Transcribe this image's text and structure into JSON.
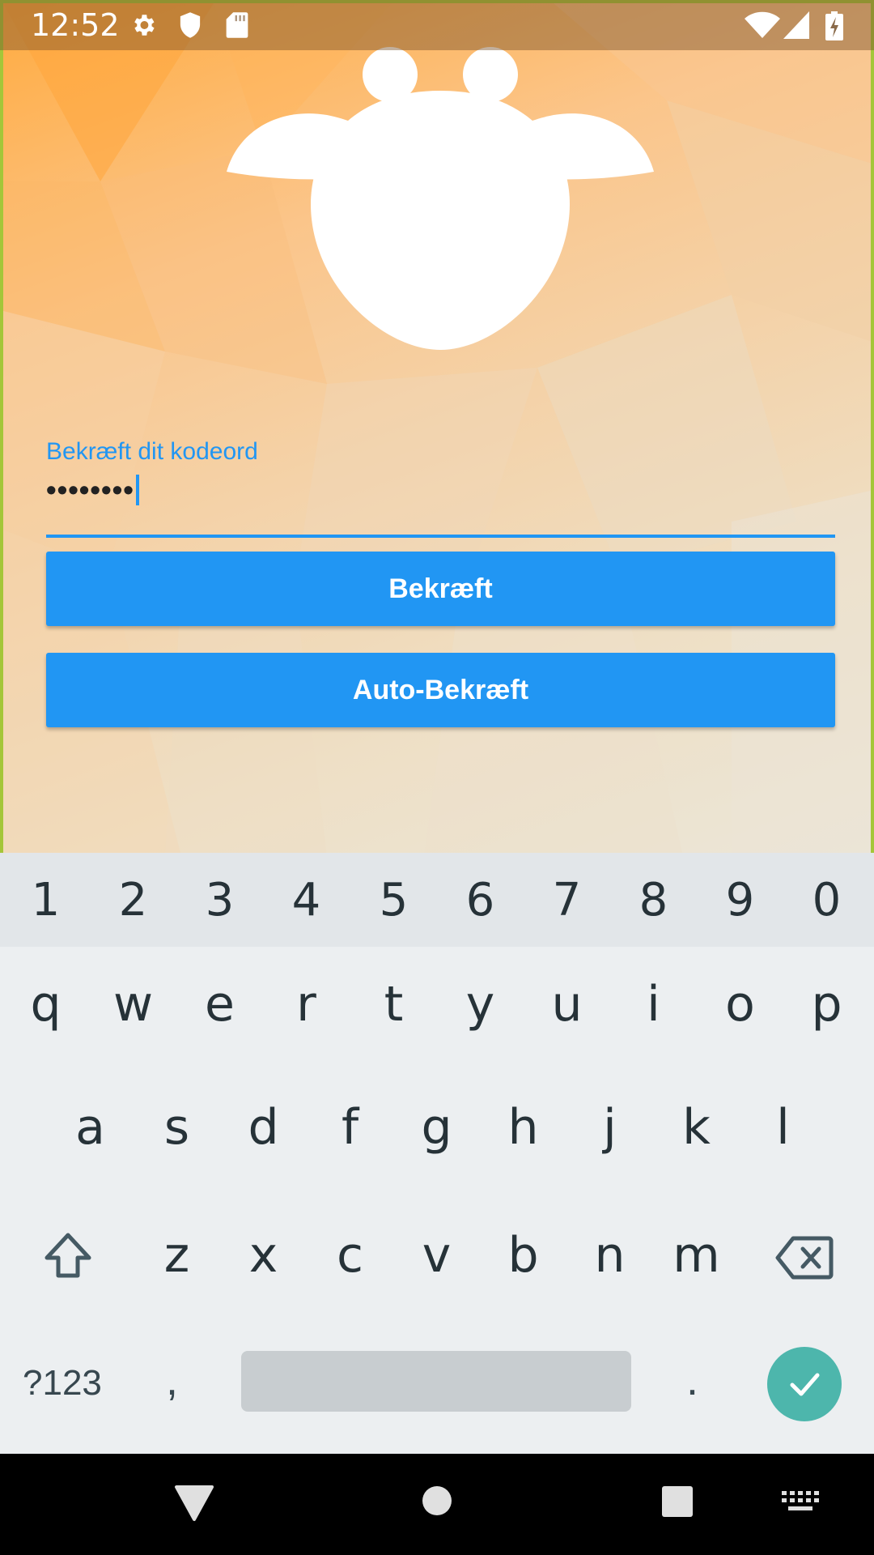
{
  "status_bar": {
    "time": "12:52",
    "icons": [
      "settings-icon",
      "shield-icon",
      "sd-card-icon",
      "wifi-icon",
      "signal-icon",
      "battery-charging-icon"
    ]
  },
  "login": {
    "field_label": "Bekræft dit kodeord",
    "password_value": "••••••••",
    "confirm_button": "Bekræft",
    "auto_confirm_button": "Auto-Bekræft"
  },
  "keyboard": {
    "number_row": [
      "1",
      "2",
      "3",
      "4",
      "5",
      "6",
      "7",
      "8",
      "9",
      "0"
    ],
    "row_q": [
      "q",
      "w",
      "e",
      "r",
      "t",
      "y",
      "u",
      "i",
      "o",
      "p"
    ],
    "row_a": [
      "a",
      "s",
      "d",
      "f",
      "g",
      "h",
      "j",
      "k",
      "l"
    ],
    "row_z": [
      "z",
      "x",
      "c",
      "v",
      "b",
      "n",
      "m"
    ],
    "symbols_key": "?123",
    "comma": ",",
    "period": ".",
    "icons": [
      "shift-icon",
      "backspace-icon",
      "check-icon"
    ]
  },
  "nav_bar": {
    "icons": [
      "back-icon",
      "home-icon",
      "recents-icon",
      "keyboard-switch-icon"
    ]
  },
  "colors": {
    "accent": "#2196f3",
    "enter_key": "#4db6ac",
    "keyboard_bg": "#eceff1"
  }
}
